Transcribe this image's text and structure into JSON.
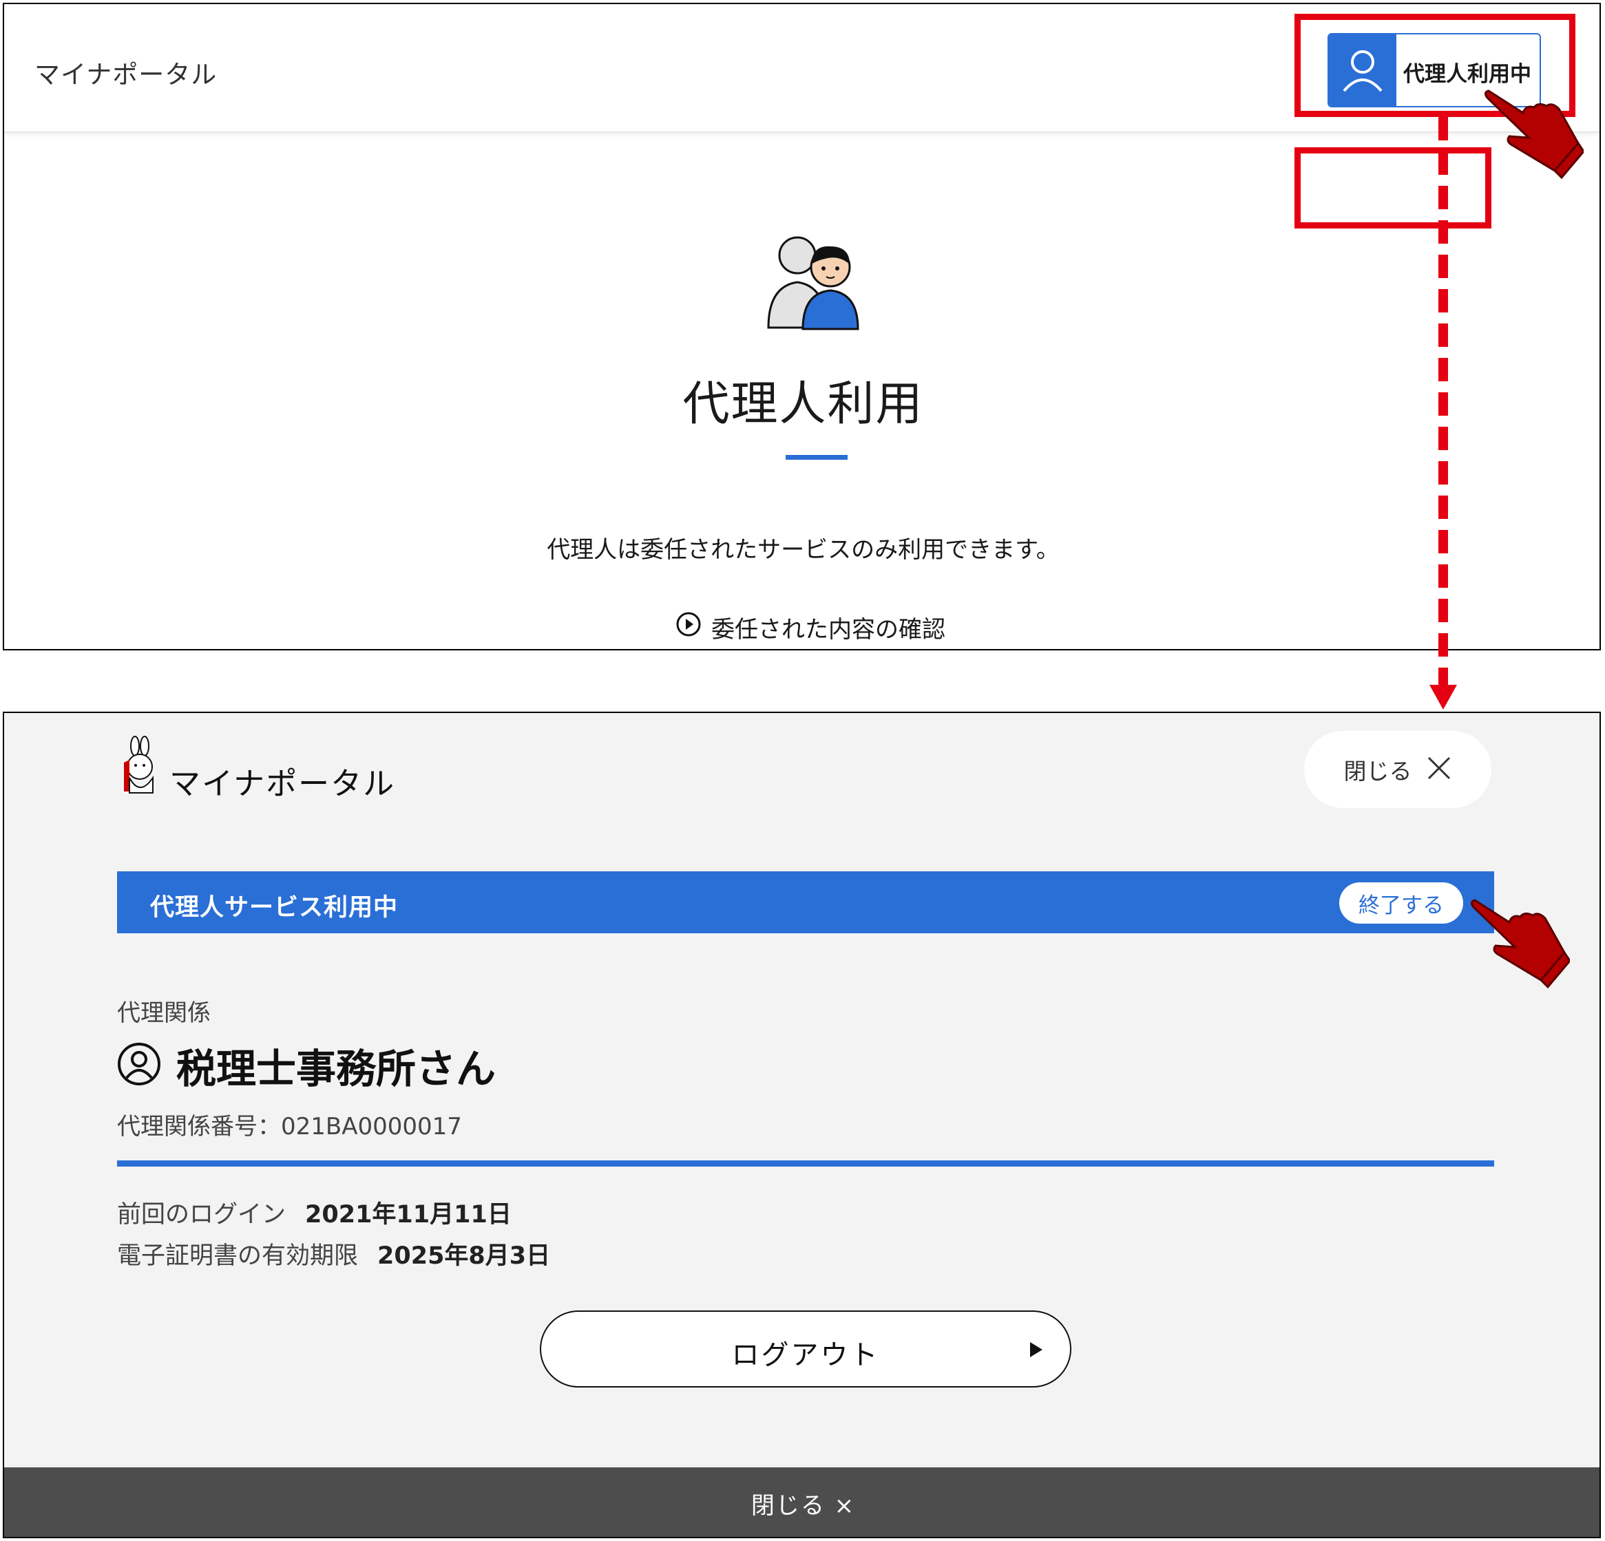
{
  "top": {
    "header_logo": "マイナポータル",
    "proxy_status_button": "代理人利用中",
    "title": "代理人利用",
    "description": "代理人は委任されたサービスのみ利用できます。",
    "confirm_link": "委任された内容の確認"
  },
  "bottom": {
    "logo_text": "マイナポータル",
    "close_button": "閉じる",
    "proxy_bar_label": "代理人サービス利用中",
    "end_button": "終了する",
    "relation_caption": "代理関係",
    "relation_name": "税理士事務所さん",
    "relation_number": "代理関係番号：021BA0000017",
    "last_login_label": "前回のログイン",
    "last_login_value": "2021年11月11日",
    "cert_expiry_label": "電子証明書の有効期限",
    "cert_expiry_value": "2025年8月3日",
    "logout_button": "ログアウト",
    "footer_close": "閉じる ×"
  },
  "colors": {
    "accent_blue": "#2a6fd6",
    "highlight_red": "#e50012",
    "pointer_hand": "#b30000",
    "footer_gray": "#4d4d4d"
  },
  "icons": [
    "user-icon",
    "proxy-illustration",
    "play-circle-icon",
    "mascot-logo-icon",
    "close-icon",
    "user-circle-icon",
    "pointer-hand-icon",
    "play-triangle-icon"
  ]
}
